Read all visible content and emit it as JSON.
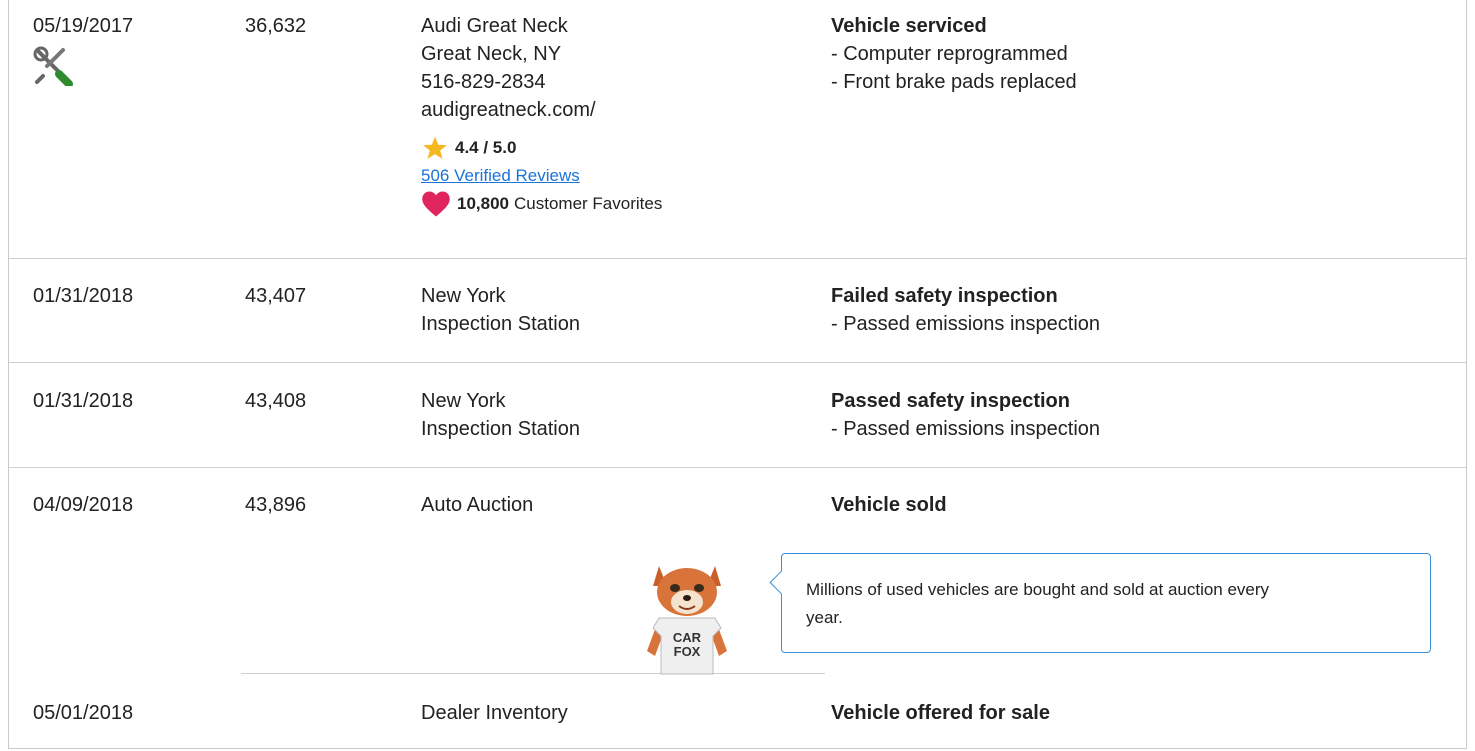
{
  "records": [
    {
      "date": "05/19/2017",
      "odometer": "36,632",
      "icon": "service-tools-icon",
      "source_lines": [
        "Audi Great Neck",
        "Great Neck, NY",
        "516-829-2834",
        "audigreatneck.com/"
      ],
      "rating": "4.4 / 5.0",
      "reviews_link": "506 Verified Reviews",
      "favorites_count": "10,800",
      "favorites_label": "Customer Favorites",
      "comment_title": "Vehicle serviced",
      "comment_lines": [
        "- Computer reprogrammed",
        "- Front brake pads replaced"
      ]
    },
    {
      "date": "01/31/2018",
      "odometer": "43,407",
      "source_lines": [
        "New York",
        "Inspection Station"
      ],
      "comment_title": "Failed safety inspection",
      "comment_lines": [
        "- Passed emissions inspection"
      ]
    },
    {
      "date": "01/31/2018",
      "odometer": "43,408",
      "source_lines": [
        "New York",
        "Inspection Station"
      ],
      "comment_title": "Passed safety inspection",
      "comment_lines": [
        "- Passed emissions inspection"
      ]
    },
    {
      "date": "04/09/2018",
      "odometer": "43,896",
      "source_lines": [
        "Auto Auction"
      ],
      "comment_title": "Vehicle sold",
      "tip_lines": [
        "Millions of used vehicles are bought and sold at auction every",
        "year."
      ],
      "mascot_shirt_lines": [
        "CAR",
        "FOX"
      ]
    },
    {
      "date": "05/01/2018",
      "odometer": "",
      "source_lines": [
        "Dealer Inventory"
      ],
      "comment_title": "Vehicle offered for sale"
    }
  ],
  "colors": {
    "link": "#1a73d9",
    "star": "#f5b820",
    "heart": "#e0245e",
    "tooltip_border": "#3a8fd9",
    "divider": "#cfcfcf"
  },
  "icons": [
    "service-tools-icon",
    "star-icon",
    "heart-icon",
    "carfox-mascot"
  ]
}
